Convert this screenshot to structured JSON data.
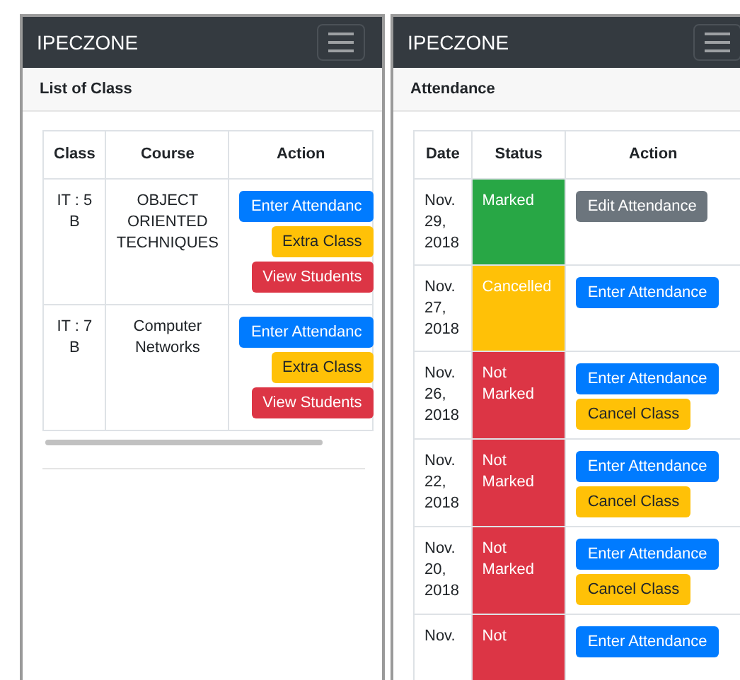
{
  "screens": [
    {
      "brand": "IPECZONE",
      "card_title": "List of Class",
      "columns": [
        "Class",
        "Course",
        "Action"
      ],
      "scrolls": true,
      "rows": [
        {
          "cells": [
            "IT : 5 B",
            "OBJECT ORIENTED TECHNIQUES"
          ],
          "buttons": [
            {
              "label": "Enter Attendanc",
              "kind": "primary"
            },
            {
              "label": "Extra Class",
              "kind": "warning"
            },
            {
              "label": "View Students",
              "kind": "danger"
            }
          ]
        },
        {
          "cells": [
            "IT : 7 B",
            "Computer Networks"
          ],
          "buttons": [
            {
              "label": "Enter Attendanc",
              "kind": "primary"
            },
            {
              "label": "Extra Class",
              "kind": "warning"
            },
            {
              "label": "View Students",
              "kind": "danger"
            }
          ]
        }
      ]
    },
    {
      "brand": "IPECZONE",
      "card_title": "Attendance",
      "columns": [
        "Date",
        "Status",
        "Action"
      ],
      "rows": [
        {
          "cells": [
            "Nov. 29, 2018"
          ],
          "status": {
            "label": "Marked",
            "kind": "marked"
          },
          "buttons": [
            {
              "label": "Edit Attendance",
              "kind": "secondary"
            }
          ]
        },
        {
          "cells": [
            "Nov. 27, 2018"
          ],
          "status": {
            "label": "Cancelled",
            "kind": "cancelled"
          },
          "buttons": [
            {
              "label": "Enter Attendance",
              "kind": "primary"
            }
          ]
        },
        {
          "cells": [
            "Nov. 26, 2018"
          ],
          "status": {
            "label": "Not Marked",
            "kind": "not_marked"
          },
          "buttons": [
            {
              "label": "Enter Attendance",
              "kind": "primary"
            },
            {
              "label": "Cancel Class",
              "kind": "warning"
            }
          ]
        },
        {
          "cells": [
            "Nov. 22, 2018"
          ],
          "status": {
            "label": "Not Marked",
            "kind": "not_marked"
          },
          "buttons": [
            {
              "label": "Enter Attendance",
              "kind": "primary"
            },
            {
              "label": "Cancel Class",
              "kind": "warning"
            }
          ]
        },
        {
          "cells": [
            "Nov. 20, 2018"
          ],
          "status": {
            "label": "Not Marked",
            "kind": "not_marked"
          },
          "buttons": [
            {
              "label": "Enter Attendance",
              "kind": "primary"
            },
            {
              "label": "Cancel Class",
              "kind": "warning"
            }
          ]
        },
        {
          "cells": [
            "Nov."
          ],
          "status": {
            "label": "Not",
            "kind": "not_marked"
          },
          "buttons": [
            {
              "label": "Enter Attendance",
              "kind": "primary"
            }
          ]
        }
      ]
    }
  ]
}
